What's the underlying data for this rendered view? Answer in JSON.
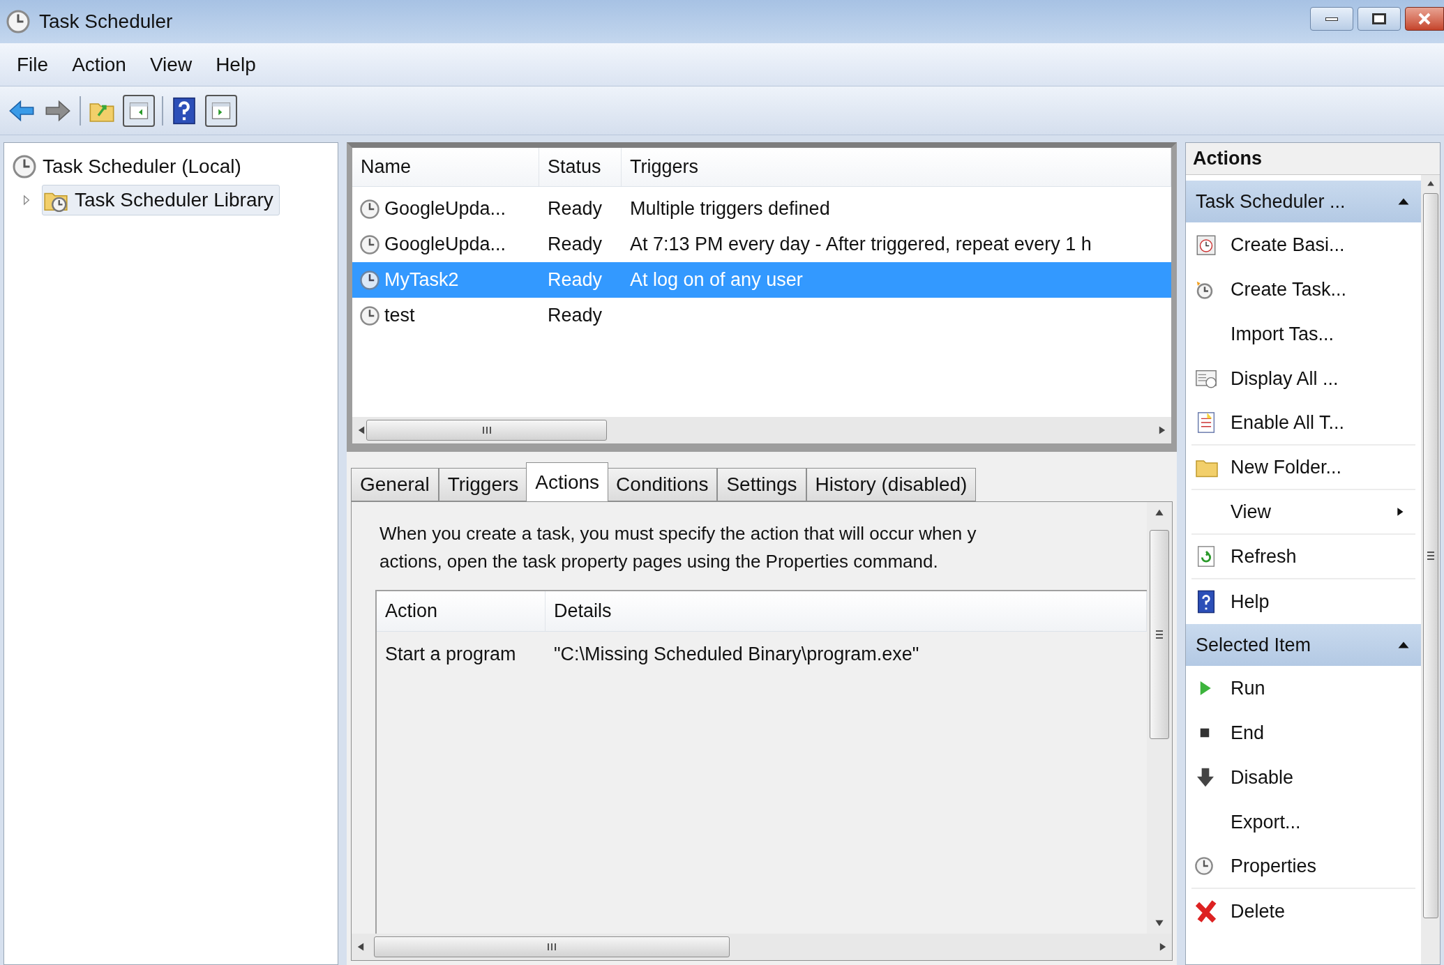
{
  "window": {
    "title": "Task Scheduler"
  },
  "menu": [
    "File",
    "Action",
    "View",
    "Help"
  ],
  "tree": [
    {
      "label": "Task Scheduler (Local)",
      "selected": false,
      "children": [
        {
          "label": "Task Scheduler Library",
          "selected": true,
          "expanded": false
        }
      ]
    }
  ],
  "task_list": {
    "columns": [
      "Name",
      "Status",
      "Triggers"
    ],
    "rows": [
      {
        "name": "GoogleUpda...",
        "status": "Ready",
        "triggers": "Multiple triggers defined",
        "selected": false
      },
      {
        "name": "GoogleUpda...",
        "status": "Ready",
        "triggers": "At 7:13 PM every day - After triggered, repeat every 1 h",
        "selected": false
      },
      {
        "name": "MyTask2",
        "status": "Ready",
        "triggers": "At log on of any user",
        "selected": true
      },
      {
        "name": "test",
        "status": "Ready",
        "triggers": "",
        "selected": false
      }
    ]
  },
  "tabs": [
    {
      "label": "General",
      "selected": false
    },
    {
      "label": "Triggers",
      "selected": false
    },
    {
      "label": "Actions",
      "selected": true
    },
    {
      "label": "Conditions",
      "selected": false
    },
    {
      "label": "Settings",
      "selected": false
    },
    {
      "label": "History (disabled)",
      "selected": false
    }
  ],
  "actions_tab": {
    "description": [
      "When you create a task, you must specify the action that will occur when y",
      "actions, open the task property pages using the Properties command."
    ],
    "columns": [
      "Action",
      "Details"
    ],
    "rows": [
      {
        "action": "Start a program",
        "details": "\"C:\\Missing Scheduled Binary\\program.exe\""
      }
    ]
  },
  "actions_pane": {
    "title": "Actions",
    "sections": [
      {
        "title": "Task Scheduler ...",
        "expanded": true,
        "items": [
          {
            "label": "Create Basi..."
          },
          {
            "label": "Create Task..."
          },
          {
            "label": "Import Tas..."
          },
          {
            "label": "Display All ..."
          },
          {
            "label": "Enable All T..."
          },
          {
            "label": "New Folder..."
          },
          {
            "label": "View",
            "submenu": true
          },
          {
            "label": "Refresh"
          },
          {
            "label": "Help"
          }
        ]
      },
      {
        "title": "Selected Item",
        "expanded": true,
        "items": [
          {
            "label": "Run"
          },
          {
            "label": "End"
          },
          {
            "label": "Disable"
          },
          {
            "label": "Export..."
          },
          {
            "label": "Properties"
          },
          {
            "label": "Delete"
          }
        ]
      }
    ]
  }
}
